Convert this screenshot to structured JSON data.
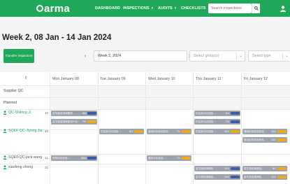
{
  "app": {
    "logo_text": "arma"
  },
  "nav": {
    "dashboard": "DASHBOARD",
    "inspections": "INSPECTIONS",
    "audits": "AUDITS",
    "checklists": "CHECKLISTS"
  },
  "search": {
    "placeholder": "Search inspections"
  },
  "week_title": "Week 2, 08 Jan - 14 Jan 2024",
  "toolbar": {
    "transfer_label": "Transfer inspectors",
    "week_select_value": "Week 2, 2024",
    "group_placeholder": "Select group(s)",
    "type_placeholder": "Select type"
  },
  "days": [
    "Mon January 08",
    "Tue January 09",
    "Wed January 10",
    "Thu January 11",
    "Fri January 12"
  ],
  "sections": {
    "supplier_qc": "Supplier QC",
    "planned": "Planned"
  },
  "inspectors": [
    {
      "name": "QC-Shilong Ji",
      "count": "10"
    },
    {
      "name": "SQEF-QC-Jiyong Jia",
      "count": "40"
    },
    {
      "name": "SQE0-QC-jack wang",
      "count": "11"
    },
    {
      "name": "xiaofeng zhong",
      "count": "31"
    }
  ],
  "tasks": [
    {
      "label": "金牛座经销商集团...",
      "count": "8/1",
      "bar": "blue"
    },
    {
      "label": "金牛座经销商集团产品...",
      "count": "7/1",
      "bar": "orange"
    },
    {
      "label": "供应商分区检验-...",
      "count": "9/1",
      "bar": "blue"
    },
    {
      "label": "供应商分区检验-...",
      "count": "7/1",
      "bar": "blue"
    },
    {
      "label": "供应商分区检验-...",
      "count": "8/1",
      "bar": "orange"
    },
    {
      "label": "通用检验检验检验...",
      "count": "7/1",
      "bar": "orange"
    },
    {
      "label": "供应商分区检验-...",
      "count": "10/1",
      "bar": "orange"
    },
    {
      "label": "通用检验检验检验...",
      "count": "10/1",
      "bar": "orange"
    },
    {
      "label": "通用检验检验检验...",
      "count": "10/1",
      "bar": "orange"
    },
    {
      "label": "家具检验检验...",
      "count": "54/1",
      "bar": "blue"
    },
    {
      "label": "通用分区检验...",
      "count": "7/1",
      "bar": "orange"
    },
    {
      "label": "金牛座经销商检...",
      "count": "12/1",
      "bar": "blue"
    },
    {
      "label": "金牛座经销商检...",
      "count": "8/1",
      "bar": "orange"
    },
    {
      "label": "金牛座经销商检...",
      "count": "10/1",
      "bar": "blue"
    },
    {
      "label": "金牛座经销商检...",
      "count": "10/1",
      "bar": "orange"
    }
  ],
  "colors": {
    "brand": "#1fa75a",
    "bar_blue": "#3b5ea8",
    "bar_orange": "#f0a81c"
  }
}
